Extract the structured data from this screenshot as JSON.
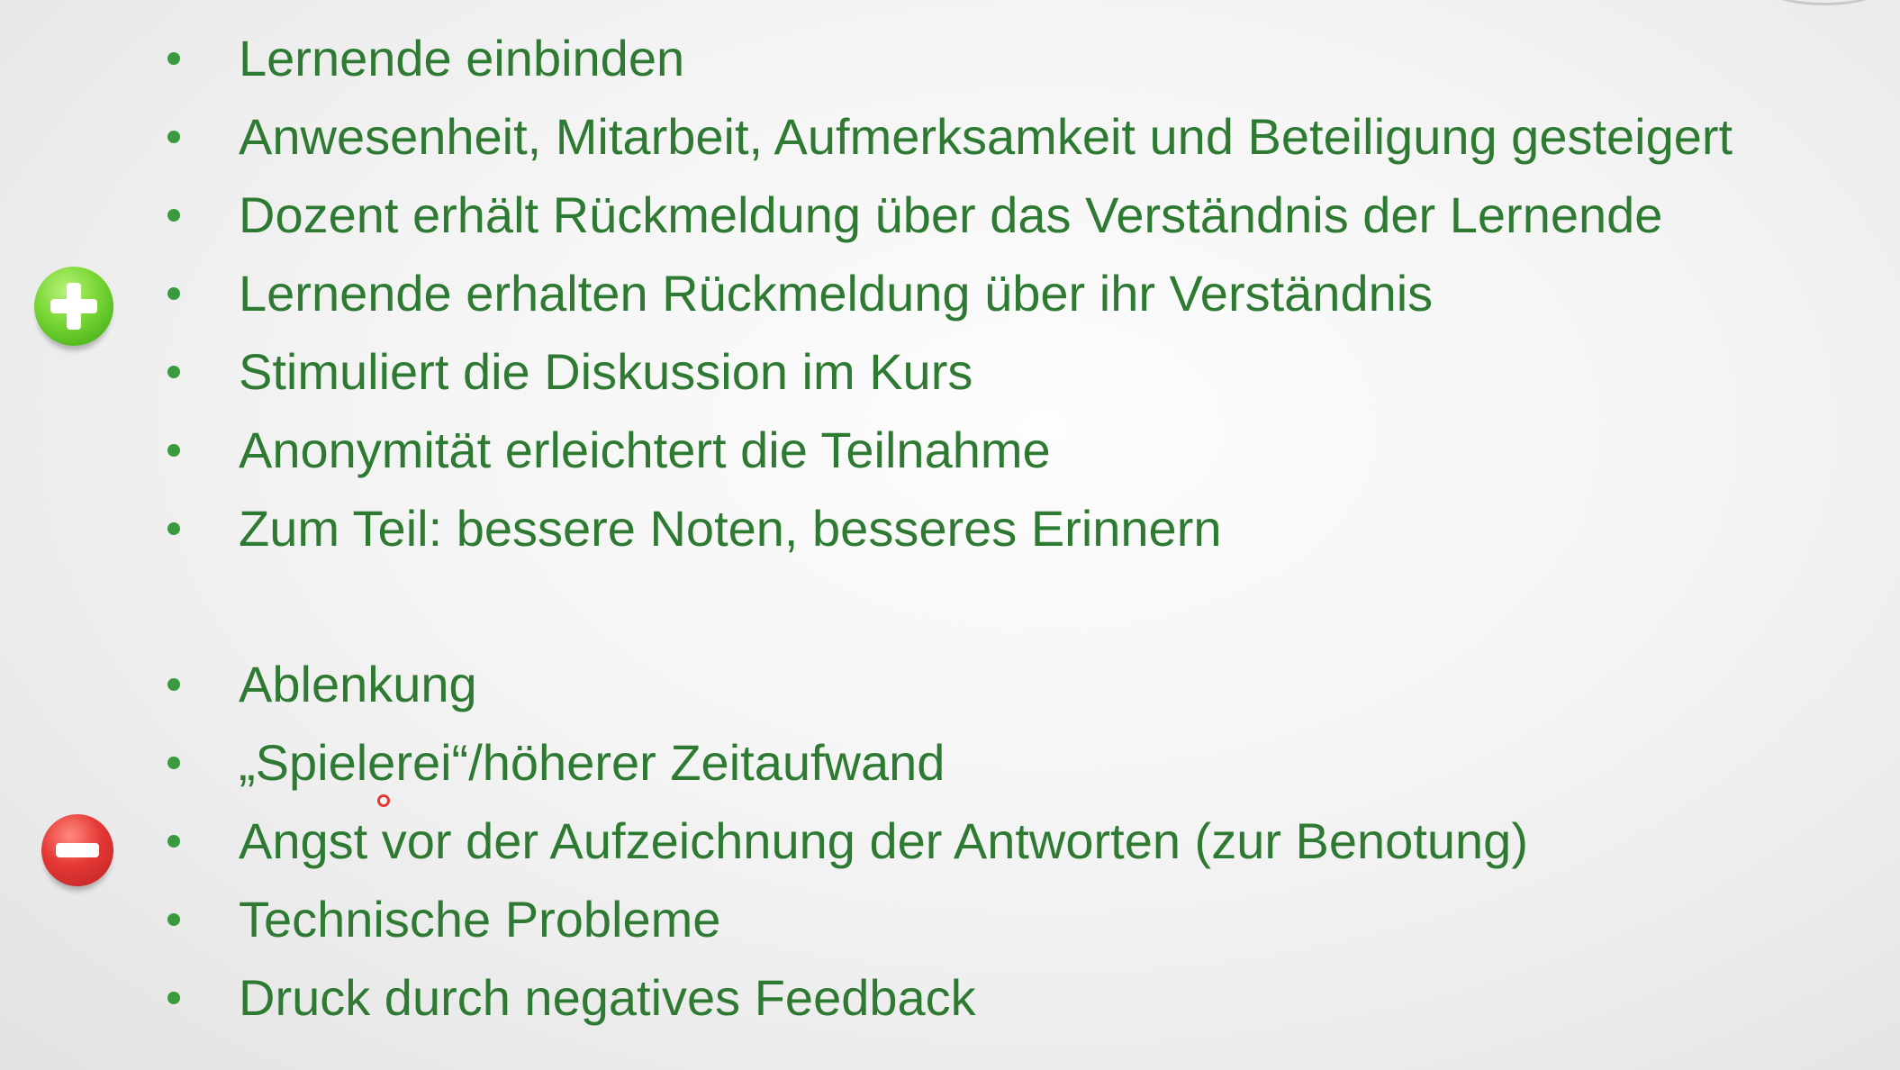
{
  "pros": {
    "icon": "plus-circle-icon",
    "accent": "#4fb81d",
    "items": [
      "Lernende einbinden",
      "Anwesenheit, Mitarbeit, Aufmerksamkeit und Beteiligung gesteigert",
      "Dozent erhält Rückmeldung über das Verständnis der Lernende",
      "Lernende erhalten Rückmeldung über ihr Verständnis",
      "Stimuliert die Diskussion im Kurs",
      "Anonymität erleichtert die Teilnahme",
      "Zum Teil: bessere Noten, besseres Erinnern"
    ]
  },
  "cons": {
    "icon": "minus-circle-icon",
    "accent": "#e53935",
    "items": [
      "Ablenkung",
      "„Spielerei“/höherer Zeitaufwand",
      "Angst vor der Aufzeichnung der Antworten (zur Benotung)",
      "Technische Probleme",
      "Druck durch negatives Feedback"
    ]
  },
  "text_color": "#2f7a33"
}
